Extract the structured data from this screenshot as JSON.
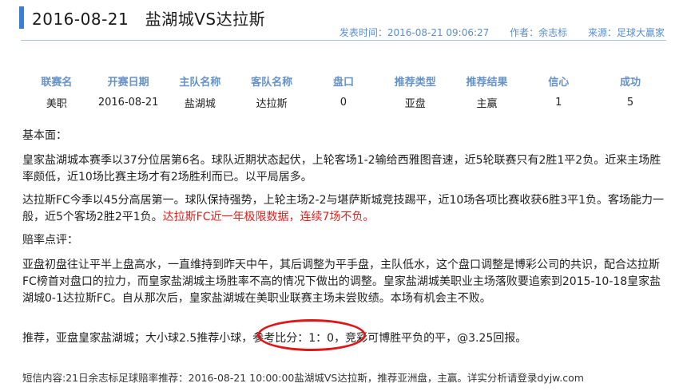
{
  "header": {
    "title": "2016-08-21　盐湖城VS达拉斯",
    "publish_time": "发表时间：2016-08-21 09:06:27",
    "author": "作者：余志标",
    "source": "来源：足球大赢家",
    "accent_color": "#3a7fd0"
  },
  "info_table": {
    "headers": [
      "联赛名",
      "开赛日期",
      "主队名称",
      "客队名称",
      "盘口",
      "推荐类型",
      "推荐结果",
      "信心",
      "成功"
    ],
    "row": [
      "美职",
      "2016-08-21",
      "盐湖城",
      "达拉斯",
      "0",
      "亚盘",
      "主赢",
      "1",
      "5"
    ]
  },
  "content": {
    "basics_heading": "基本面：",
    "para1": "皇家盐湖城本赛季以37分位居第6名。球队近期状态起伏，上轮客场1-2输给西雅图音速，近5轮联赛只有2胜1平2负。近来主场胜率颇低，近10场比赛主场才有2场胜利而已。以平局居多。",
    "para2_main": "达拉斯FC今季以45分高居第一。球队保持强势，上轮主场2-2与堪萨斯城竞技踢平，近10场各项比赛收获6胜3平1负。客场能力一般，近5个客场2胜2平1负。",
    "para2_red": "达拉斯FC近一年极限数据，连续7场不负。",
    "odds_heading": "赔率点评：",
    "para3": "亚盘初盘往让平半上盘高水，一直维持到昨天中午，其后调整为平手盘，主队低水，这个盘口调整是博彩公司的共识，配合达拉斯FC榜首对盘口的拉力，而皇家盐湖城主场胜率不高的情况下做出的调整。皇家盐湖城美职业主场落败要追索到2015-10-18皇家盐湖城0-1达拉斯FC。自从那次后，皇家盐湖城在美职业联赛主场未尝败绩。本场有机会主不败。",
    "recommend": "推荐，亚盘皇家盐湖城；大小球2.5推荐小球，参考比分：1：0，竞彩可博胜平负的平，@3.25回报。",
    "red_color": "#e0211b"
  },
  "footer": {
    "text": "短信内容:21日余志标足球赔率推荐：2016-08-21 10:00:00盐湖城VS达拉斯，推荐亚洲盘，主赢。详实分析请登录dyjw.com"
  }
}
